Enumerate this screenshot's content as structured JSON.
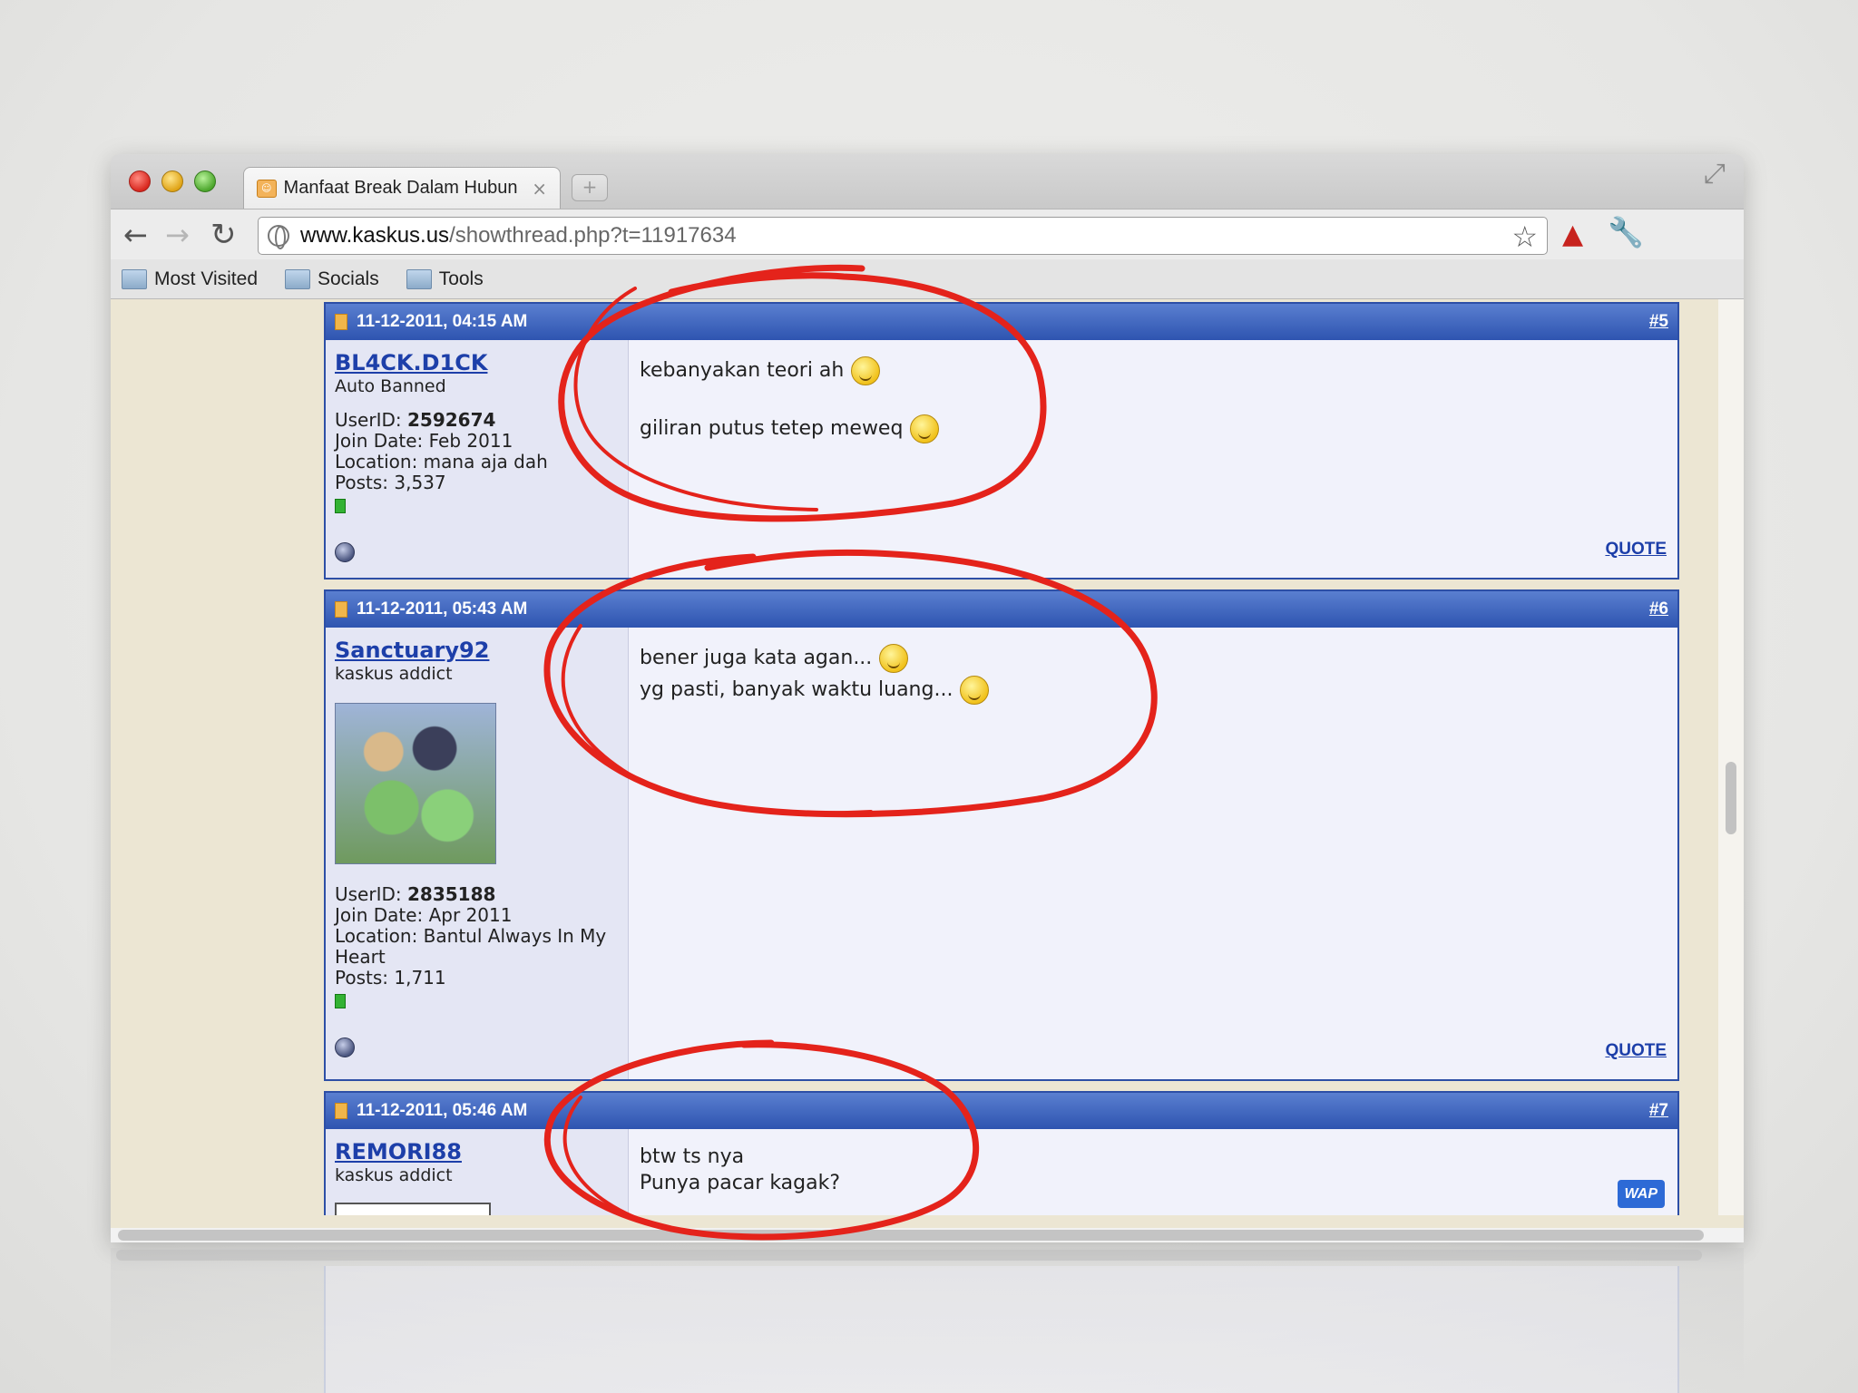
{
  "browser": {
    "tab_title": "Manfaat Break Dalam Hubun",
    "tab_close": "×",
    "new_tab": "+",
    "url_host": "www.kaskus.us",
    "url_path": "/showthread.php?t=11917634",
    "bookmarks": [
      "Most Visited",
      "Socials",
      "Tools"
    ]
  },
  "posts": [
    {
      "date": "11-12-2011, 04:15 AM",
      "num": "#5",
      "username": "BL4CK.D1CK",
      "title": "Auto Banned",
      "userid_label": "UserID:",
      "userid": "2592674",
      "join": "Join Date: Feb 2011",
      "location": "Location: mana aja dah",
      "posts": "Posts: 3,537",
      "line1": "kebanyakan teori ah",
      "line2": "giliran putus tetep meweq",
      "quote": "QUOTE"
    },
    {
      "date": "11-12-2011, 05:43 AM",
      "num": "#6",
      "username": "Sanctuary92",
      "title": "kaskus addict",
      "userid_label": "UserID:",
      "userid": "2835188",
      "join": "Join Date: Apr 2011",
      "location": "Location: Bantul Always In My Heart",
      "posts": "Posts: 1,711",
      "line1": "bener juga kata agan...",
      "line2": "yg pasti, banyak waktu luang...",
      "quote": "QUOTE"
    },
    {
      "date": "11-12-2011, 05:46 AM",
      "num": "#7",
      "username": "REMORI88",
      "title": "kaskus addict",
      "line1": "btw ts nya",
      "line2": "Punya pacar kagak?",
      "wap": "WAP"
    }
  ],
  "colors": {
    "annotation": "#e4231b",
    "post_header": "#2e54b0",
    "link": "#1d3fa9"
  }
}
